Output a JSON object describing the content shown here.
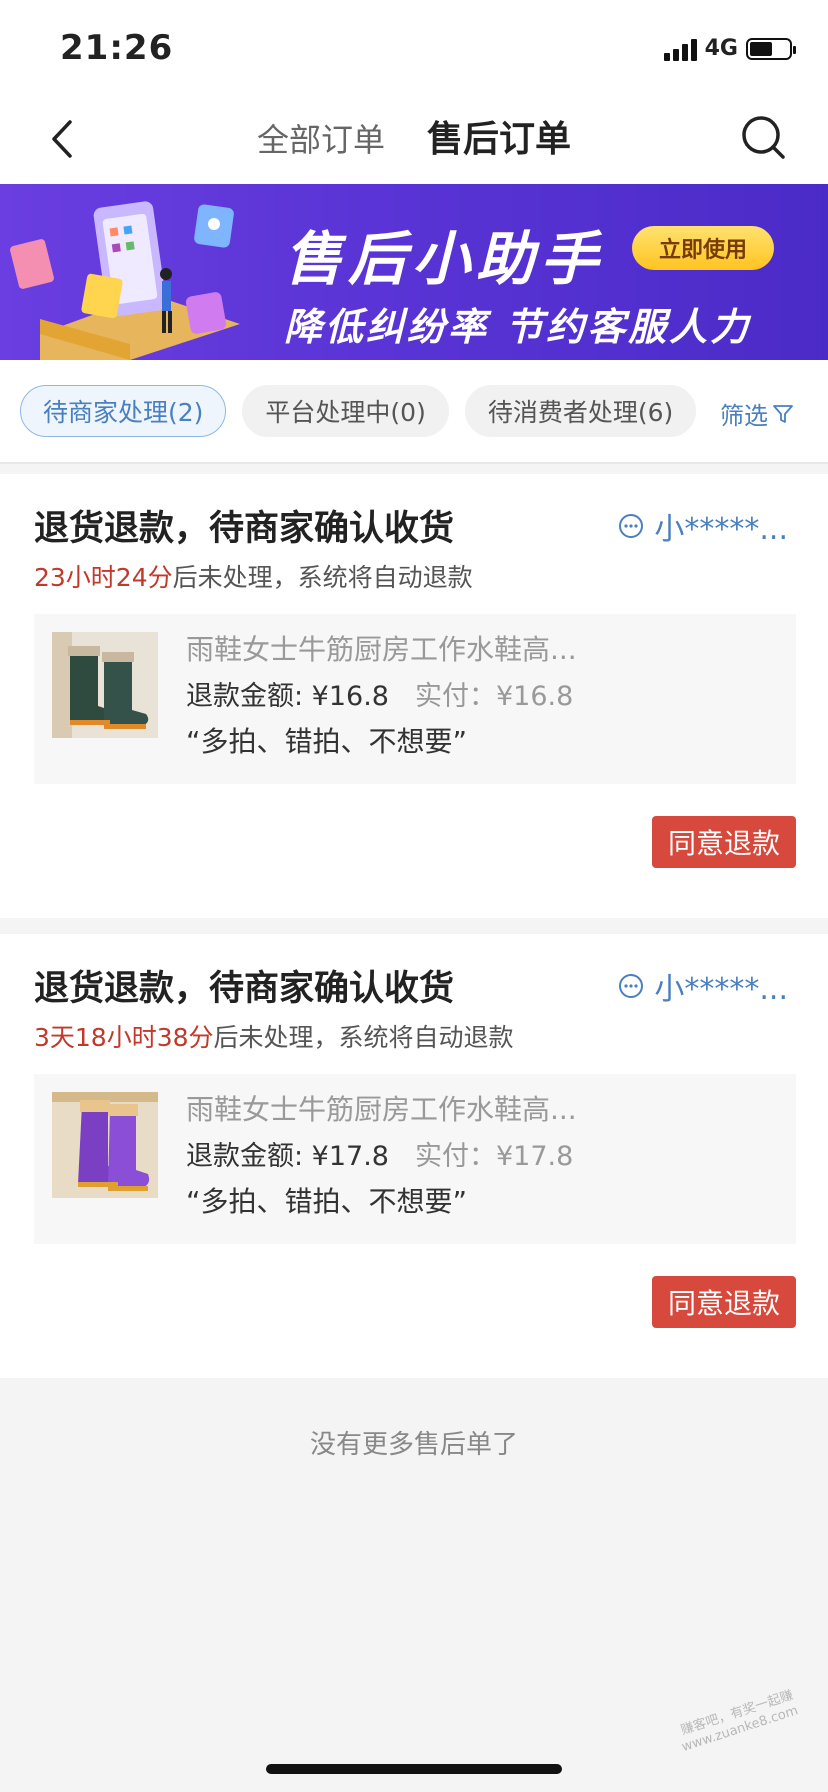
{
  "status_bar": {
    "time": "21:26",
    "network": "4G",
    "battery_level": 0.58
  },
  "nav": {
    "tabs": [
      {
        "label": "全部订单",
        "active": false
      },
      {
        "label": "售后订单",
        "active": true
      }
    ]
  },
  "banner": {
    "title": "售后小助手",
    "subtitle": "降低纠纷率 节约客服人力",
    "button_label": "立即使用"
  },
  "filters": {
    "chips": [
      {
        "label": "待商家处理(2)",
        "active": true
      },
      {
        "label": "平台处理中(0)",
        "active": false
      },
      {
        "label": "待消费者处理(6)",
        "active": false
      }
    ],
    "filter_label": "筛选"
  },
  "orders": [
    {
      "title": "退货退款，待商家确认收货",
      "buyer": "小*****...",
      "deadline_time": "23小时24分",
      "deadline_suffix": "后未处理，系统将自动退款",
      "product_name": "雨鞋女士牛筋厨房工作水鞋高...",
      "refund_amount": "退款金额: ¥16.8",
      "paid": "实付：¥16.8",
      "reason": "“多拍、错拍、不想要”",
      "button": "同意退款",
      "boot_color": "#2f4a3e"
    },
    {
      "title": "退货退款，待商家确认收货",
      "buyer": "小*****...",
      "deadline_time": "3天18小时38分",
      "deadline_suffix": "后未处理，系统将自动退款",
      "product_name": "雨鞋女士牛筋厨房工作水鞋高...",
      "refund_amount": "退款金额: ¥17.8",
      "paid": "实付：¥17.8",
      "reason": "“多拍、错拍、不想要”",
      "button": "同意退款",
      "boot_color": "#7b3fc4"
    }
  ],
  "footer": {
    "no_more": "没有更多售后单了"
  },
  "watermark": {
    "line1": "赚客吧，有奖一起赚",
    "line2": "www.zuanke8.com"
  }
}
